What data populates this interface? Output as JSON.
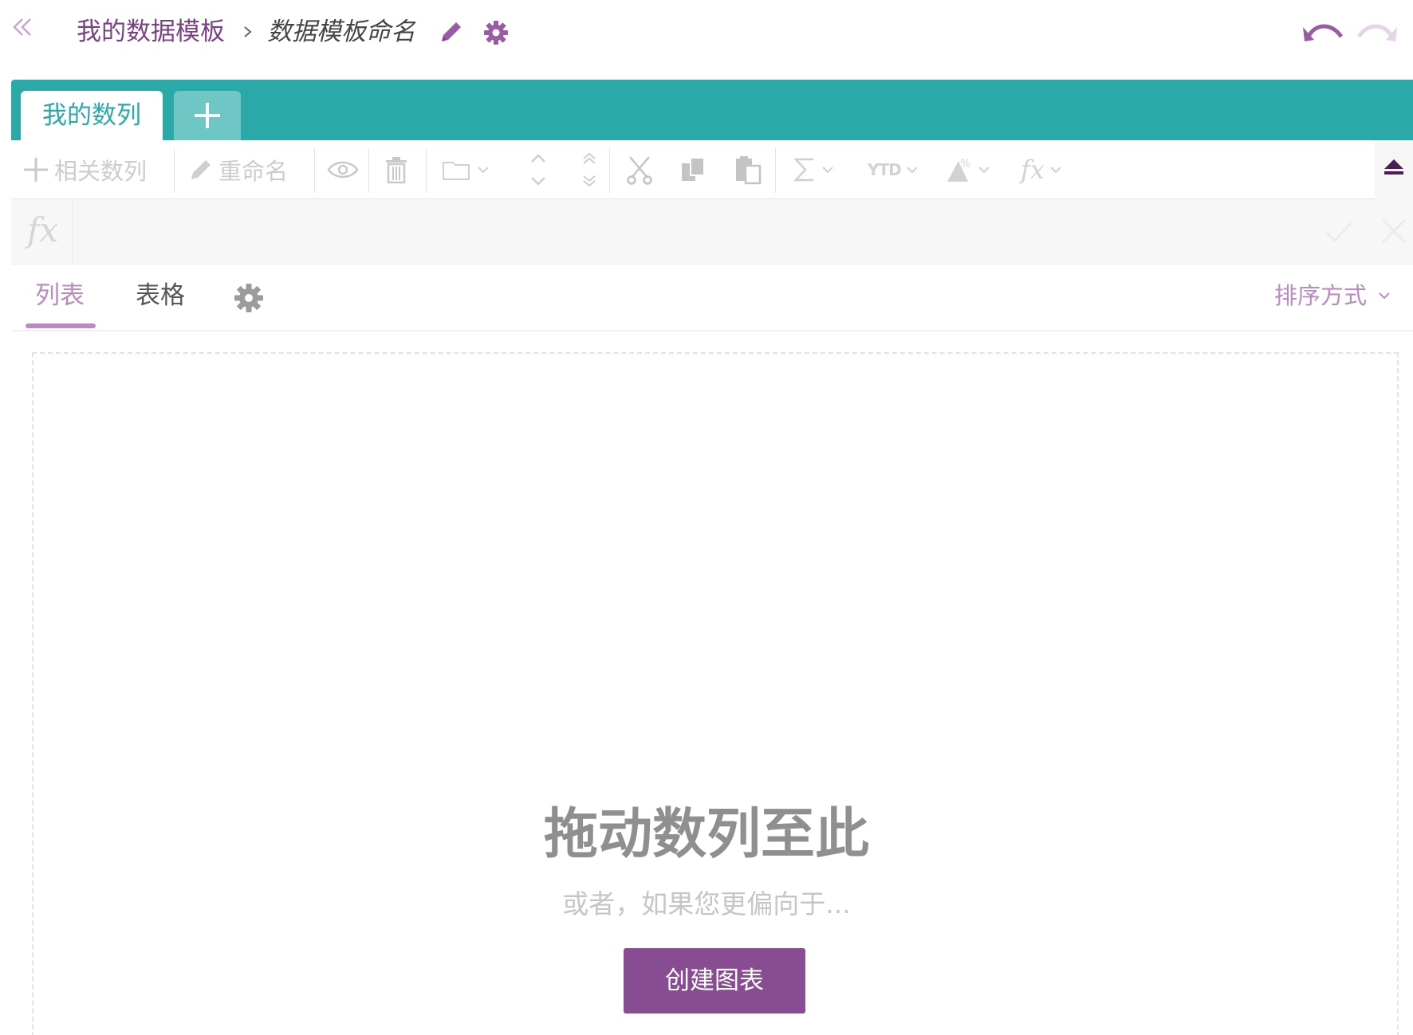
{
  "header": {
    "breadcrumb_root": "我的数据模板",
    "breadcrumb_current": "数据模板命名",
    "back_icon": "double-chevron-left-icon",
    "undo_icon": "undo-icon",
    "redo_icon": "redo-icon"
  },
  "tabs": {
    "items": [
      {
        "label": "我的数列",
        "active": true
      }
    ],
    "add_icon": "plus-icon"
  },
  "toolbar": {
    "related_series_label": "相关数列",
    "rename_label": "重命名",
    "icons": [
      "plus-icon",
      "pencil-icon",
      "eye-icon",
      "trash-icon",
      "folder-icon",
      "move-up-down-icon",
      "move-top-bottom-icon",
      "cut-icon",
      "copy-icon",
      "paste-icon",
      "sigma-icon",
      "ytd-icon",
      "percent-icon",
      "fx-icon",
      "collapse-up-icon"
    ],
    "ytd_text": "YTD",
    "fx_text": "fx",
    "disabled": true
  },
  "formula_bar": {
    "fx_label": "fx",
    "value": "",
    "placeholder": ""
  },
  "view_tabs": {
    "list_label": "列表",
    "table_label": "表格",
    "active": "list",
    "sort_label": "排序方式"
  },
  "dropzone": {
    "title": "拖动数列至此",
    "subtitle": "或者，如果您更偏向于...",
    "button_label": "创建图表"
  },
  "colors": {
    "brand_purple": "#884c93",
    "accent_lilac": "#b98bc0",
    "teal": "#2ba8a8",
    "teal_light": "#6fc7c5"
  }
}
